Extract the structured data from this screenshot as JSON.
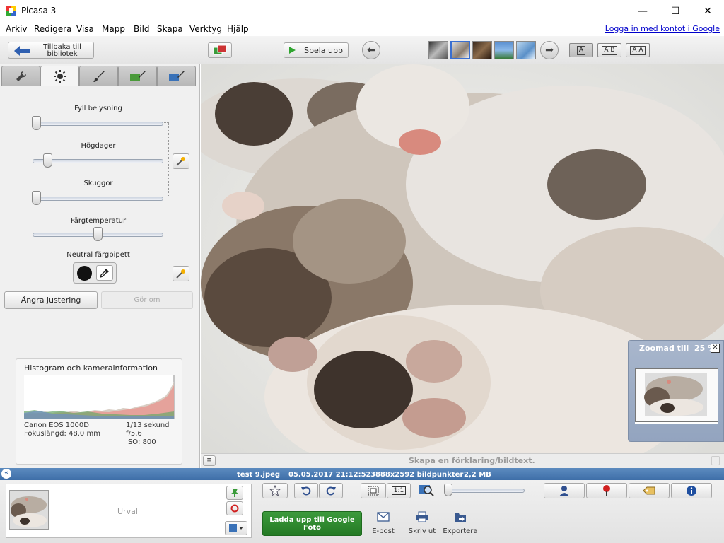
{
  "window": {
    "title": "Picasa 3",
    "min": "—",
    "max": "☐",
    "close": "✕"
  },
  "menu": [
    "Arkiv",
    "Redigera",
    "Visa",
    "Mapp",
    "Bild",
    "Skapa",
    "Verktyg",
    "Hjälp"
  ],
  "login_link": "Logga in med kontot i Google",
  "toolbar": {
    "back_label": "Tillbaka till bibliotek",
    "play_label": "Spela upp",
    "view_modes": [
      "A",
      "A B",
      "A A"
    ]
  },
  "panel": {
    "sliders": [
      {
        "label": "Fyll belysning",
        "value": 0.0
      },
      {
        "label": "Högdager",
        "value": 0.09
      },
      {
        "label": "Skuggor",
        "value": 0.0
      },
      {
        "label": "Färgtemperatur",
        "value": 0.5
      }
    ],
    "neutral_label": "Neutral färgpipett",
    "undo_label": "Ångra justering",
    "redo_label": "Gör om"
  },
  "histogram": {
    "title": "Histogram och kamerainformation",
    "camera": "Canon EOS 1000D",
    "focal": "Fokuslängd: 48.0 mm",
    "shutter": "1/13 sekund",
    "aperture": "f/5.6",
    "iso": "ISO: 800"
  },
  "photo": {
    "caption_placeholder": "Skapa en förklaring/bildtext."
  },
  "zoom": {
    "label": "Zoomad till",
    "value": "25 %",
    "close": "✕"
  },
  "status": {
    "filename": "test 9.jpeg",
    "datetime": "05.05.2017 21:12:52",
    "dimensions": "3888x2592 bildpunkter",
    "size": "2,2 MB"
  },
  "bottom": {
    "tray_label": "Urval",
    "upload_label": "Ladda upp till Google Foto",
    "email_label": "E-post",
    "print_label": "Skriv ut",
    "export_label": "Exportera",
    "zoom_value": 0.1
  },
  "colors": {
    "accent": "#3e6ea8",
    "upload": "#2e8b2e"
  }
}
